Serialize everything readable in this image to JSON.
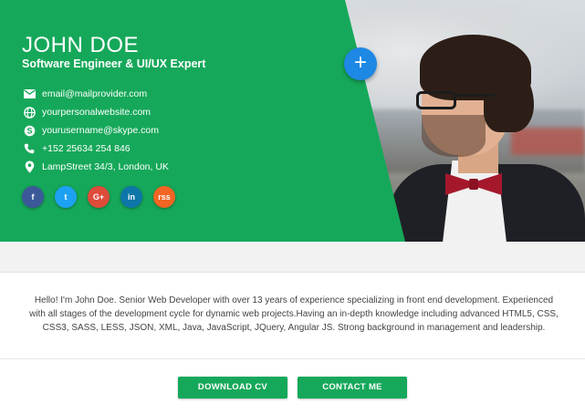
{
  "profile": {
    "name": "JOHN DOE",
    "role": "Software Engineer & UI/UX Expert"
  },
  "contacts": [
    {
      "icon": "email-icon",
      "text": "email@mailprovider.com"
    },
    {
      "icon": "globe-icon",
      "text": "yourpersonalwebsite.com"
    },
    {
      "icon": "skype-icon",
      "text": "yourusername@skype.com"
    },
    {
      "icon": "phone-icon",
      "text": "+152 25634 254 846"
    },
    {
      "icon": "location-pin-icon",
      "text": "LampStreet 34/3, London, UK"
    }
  ],
  "socials": [
    {
      "icon": "facebook-icon",
      "glyph": "f",
      "color": "#3b5998"
    },
    {
      "icon": "twitter-icon",
      "glyph": "t",
      "color": "#1da1f2"
    },
    {
      "icon": "google-plus-icon",
      "glyph": "G+",
      "color": "#dd4b39"
    },
    {
      "icon": "linkedin-icon",
      "glyph": "in",
      "color": "#0e76a8"
    },
    {
      "icon": "rss-icon",
      "glyph": "rss",
      "color": "#f26522"
    }
  ],
  "fab": {
    "icon": "plus-icon",
    "glyph": "+"
  },
  "bio": "Hello! I'm John Doe. Senior Web Developer with over 13 years of experience specializing in front end development. Experienced with all stages of the development cycle for dynamic web projects.Having an in-depth knowledge including advanced HTML5, CSS, CSS3, SASS, LESS, JSON, XML, Java, JavaScript, JQuery, Angular JS. Strong background in management and leadership.",
  "actions": {
    "download_label": "DOWNLOAD CV",
    "contact_label": "CONTACT ME"
  },
  "colors": {
    "brand_green": "#16a85a",
    "fab_blue": "#1e88e5"
  }
}
